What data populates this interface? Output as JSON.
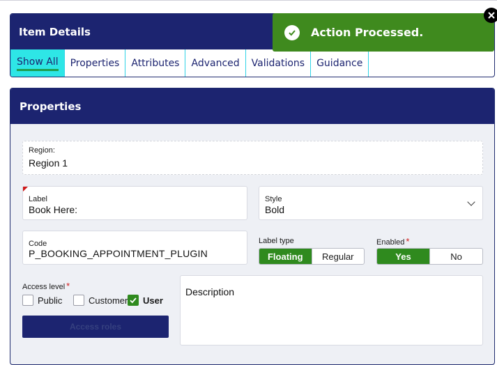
{
  "item_details": {
    "title": "Item Details",
    "tabs": [
      {
        "label": "Show All",
        "active": true
      },
      {
        "label": "Properties",
        "active": false
      },
      {
        "label": "Attributes",
        "active": false
      },
      {
        "label": "Advanced",
        "active": false
      },
      {
        "label": "Validations",
        "active": false
      },
      {
        "label": "Guidance",
        "active": false
      }
    ]
  },
  "toast": {
    "message": "Action Processed.",
    "icon": "check-circle-icon",
    "close_icon": "close-icon",
    "color": "#3f8a1e"
  },
  "properties": {
    "title": "Properties",
    "region": {
      "label": "Region:",
      "value": "Region 1"
    },
    "label_field": {
      "label": "Label",
      "value": "Book Here:"
    },
    "style_field": {
      "label": "Style",
      "value": "Bold",
      "icon": "chevron-down-icon"
    },
    "code_field": {
      "label": "Code",
      "value": "P_BOOKING_APPOINTMENT_PLUGIN"
    },
    "label_type": {
      "label": "Label type",
      "options": [
        "Floating",
        "Regular"
      ],
      "selected": "Floating"
    },
    "enabled": {
      "label": "Enabled",
      "required_mark": "*",
      "options": [
        "Yes",
        "No"
      ],
      "selected": "Yes"
    },
    "access_level": {
      "label": "Access level",
      "required_mark": "*",
      "options": [
        {
          "label": "Public",
          "checked": false
        },
        {
          "label": "Customer",
          "checked": false
        },
        {
          "label": "User",
          "checked": true
        }
      ]
    },
    "access_roles_button": "Access roles",
    "description": {
      "placeholder": "Description"
    }
  },
  "colors": {
    "header_navy": "#1c2470",
    "active_tab": "#2ee6e6",
    "selected_green": "#2f8a1e",
    "required_red": "#d01818"
  }
}
